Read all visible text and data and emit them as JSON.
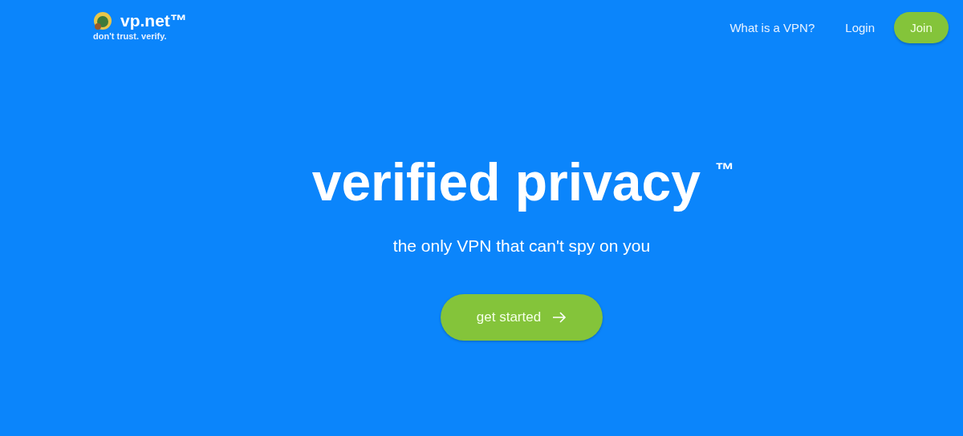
{
  "logo": {
    "name": "vp.net™",
    "tagline": "don't trust. verify."
  },
  "nav": [
    {
      "label": "What is a VPN?",
      "kind": "link"
    },
    {
      "label": "Login",
      "kind": "link"
    },
    {
      "label": "Join",
      "kind": "button"
    }
  ],
  "hero": {
    "title": "verified privacy $^{™}$",
    "subtitle": "the only VPN that can't spy on you",
    "cta": "get started"
  }
}
